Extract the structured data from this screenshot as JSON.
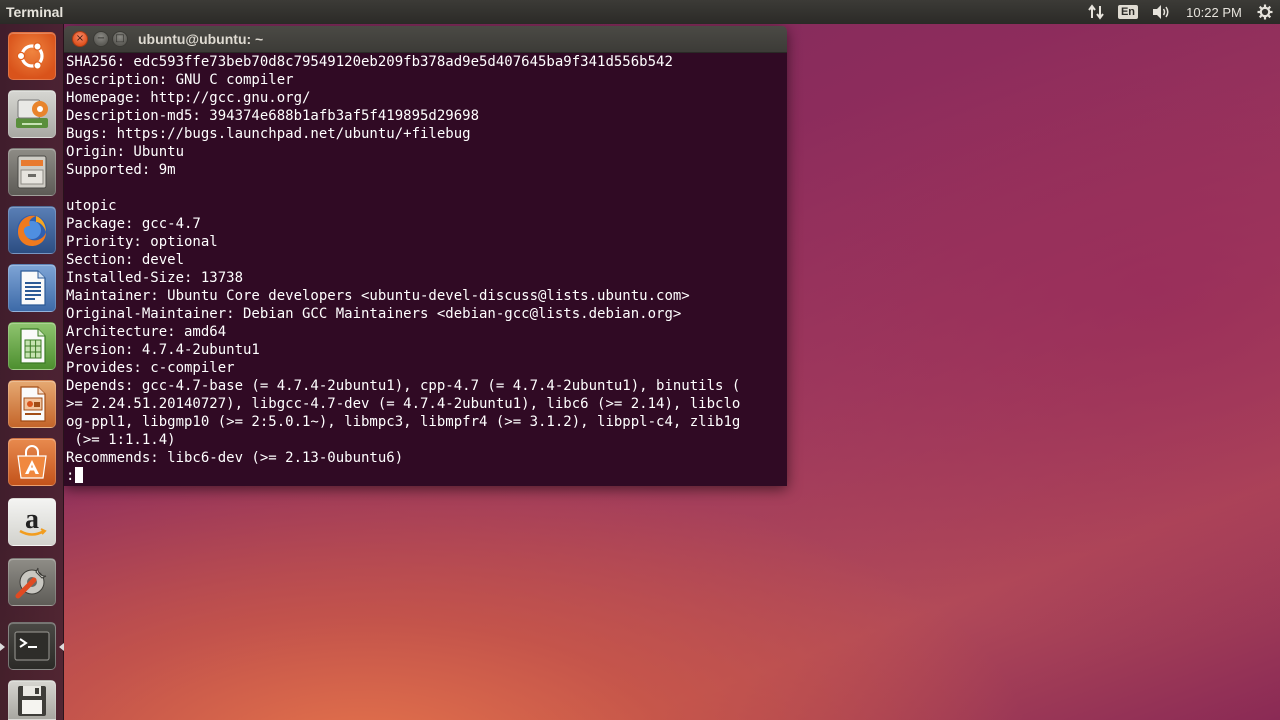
{
  "top_panel": {
    "app_title": "Terminal",
    "keyboard_layout": "En",
    "clock": "10:22 PM",
    "icons": {
      "network": "network-updown-icon",
      "volume": "volume-icon",
      "session": "gear-icon"
    }
  },
  "launcher": {
    "items": [
      {
        "name": "ubuntu-dash",
        "icon": "ubuntu-logo-icon"
      },
      {
        "name": "system-settings-app",
        "icon": "system-settings-icon"
      },
      {
        "name": "files-app",
        "icon": "file-cabinet-icon"
      },
      {
        "name": "firefox-app",
        "icon": "firefox-icon"
      },
      {
        "name": "libreoffice-writer-app",
        "icon": "writer-icon"
      },
      {
        "name": "libreoffice-calc-app",
        "icon": "calc-icon"
      },
      {
        "name": "libreoffice-impress-app",
        "icon": "impress-icon"
      },
      {
        "name": "ubuntu-software-center-app",
        "icon": "software-center-icon"
      },
      {
        "name": "amazon-app",
        "icon": "amazon-icon"
      },
      {
        "name": "system-tools-app",
        "icon": "wrench-icon"
      },
      {
        "name": "terminal-app",
        "icon": "terminal-icon"
      },
      {
        "name": "disks-app",
        "icon": "floppy-icon"
      }
    ]
  },
  "window": {
    "title": "ubuntu@ubuntu: ~",
    "buttons": {
      "close": "×",
      "minimize": "−",
      "maximize": "□"
    }
  },
  "terminal": {
    "lines": [
      "SHA256: edc593ffe73beb70d8c79549120eb209fb378ad9e5d407645ba9f341d556b542",
      "Description: GNU C compiler",
      "Homepage: http://gcc.gnu.org/",
      "Description-md5: 394374e688b1afb3af5f419895d29698",
      "Bugs: https://bugs.launchpad.net/ubuntu/+filebug",
      "Origin: Ubuntu",
      "Supported: 9m",
      "",
      "utopic",
      "Package: gcc-4.7",
      "Priority: optional",
      "Section: devel",
      "Installed-Size: 13738",
      "Maintainer: Ubuntu Core developers <ubuntu-devel-discuss@lists.ubuntu.com>",
      "Original-Maintainer: Debian GCC Maintainers <debian-gcc@lists.debian.org>",
      "Architecture: amd64",
      "Version: 4.7.4-2ubuntu1",
      "Provides: c-compiler",
      "Depends: gcc-4.7-base (= 4.7.4-2ubuntu1), cpp-4.7 (= 4.7.4-2ubuntu1), binutils (",
      ">= 2.24.51.20140727), libgcc-4.7-dev (= 4.7.4-2ubuntu1), libc6 (>= 2.14), libclo",
      "og-ppl1, libgmp10 (>= 2:5.0.1~), libmpc3, libmpfr4 (>= 3.1.2), libppl-c4, zlib1g",
      " (>= 1:1.1.4)",
      "Recommends: libc6-dev (>= 2.13-0ubuntu6)"
    ],
    "prompt": ":"
  }
}
